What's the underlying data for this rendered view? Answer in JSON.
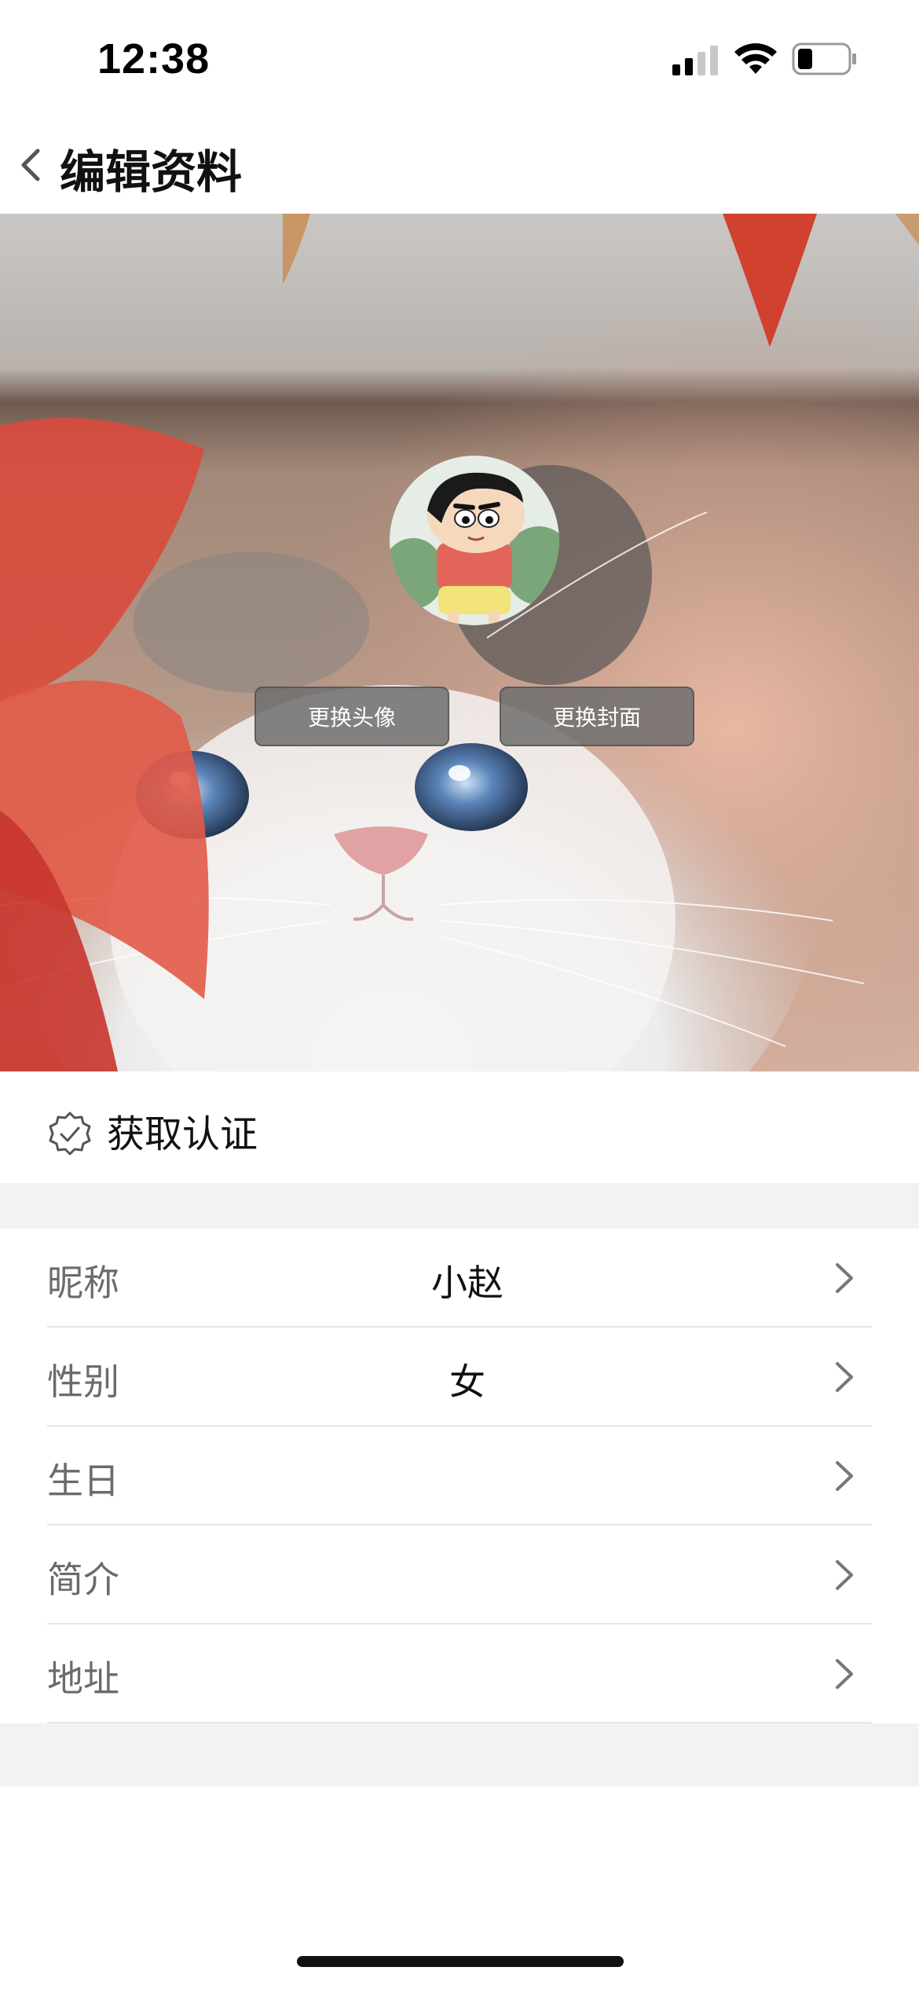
{
  "status_bar": {
    "time": "12:38",
    "icons": [
      "cellular-signal-icon",
      "wifi-icon",
      "battery-icon"
    ]
  },
  "nav": {
    "back_icon": "chevron-left-icon",
    "title": "编辑资料"
  },
  "cover": {
    "change_avatar_label": "更换头像",
    "change_cover_label": "更换封面"
  },
  "certification": {
    "icon": "verified-badge-icon",
    "label": "获取认证"
  },
  "profile_fields": [
    {
      "label": "昵称",
      "value": "小赵"
    },
    {
      "label": "性别",
      "value": "女"
    },
    {
      "label": "生日",
      "value": ""
    },
    {
      "label": "简介",
      "value": ""
    },
    {
      "label": "地址",
      "value": ""
    }
  ],
  "colors": {
    "background": "#ffffff",
    "section_gap": "#f2f2f2",
    "label_gray": "#6b6b6b",
    "text": "#111111",
    "button_bg": "#6e6e6e"
  }
}
